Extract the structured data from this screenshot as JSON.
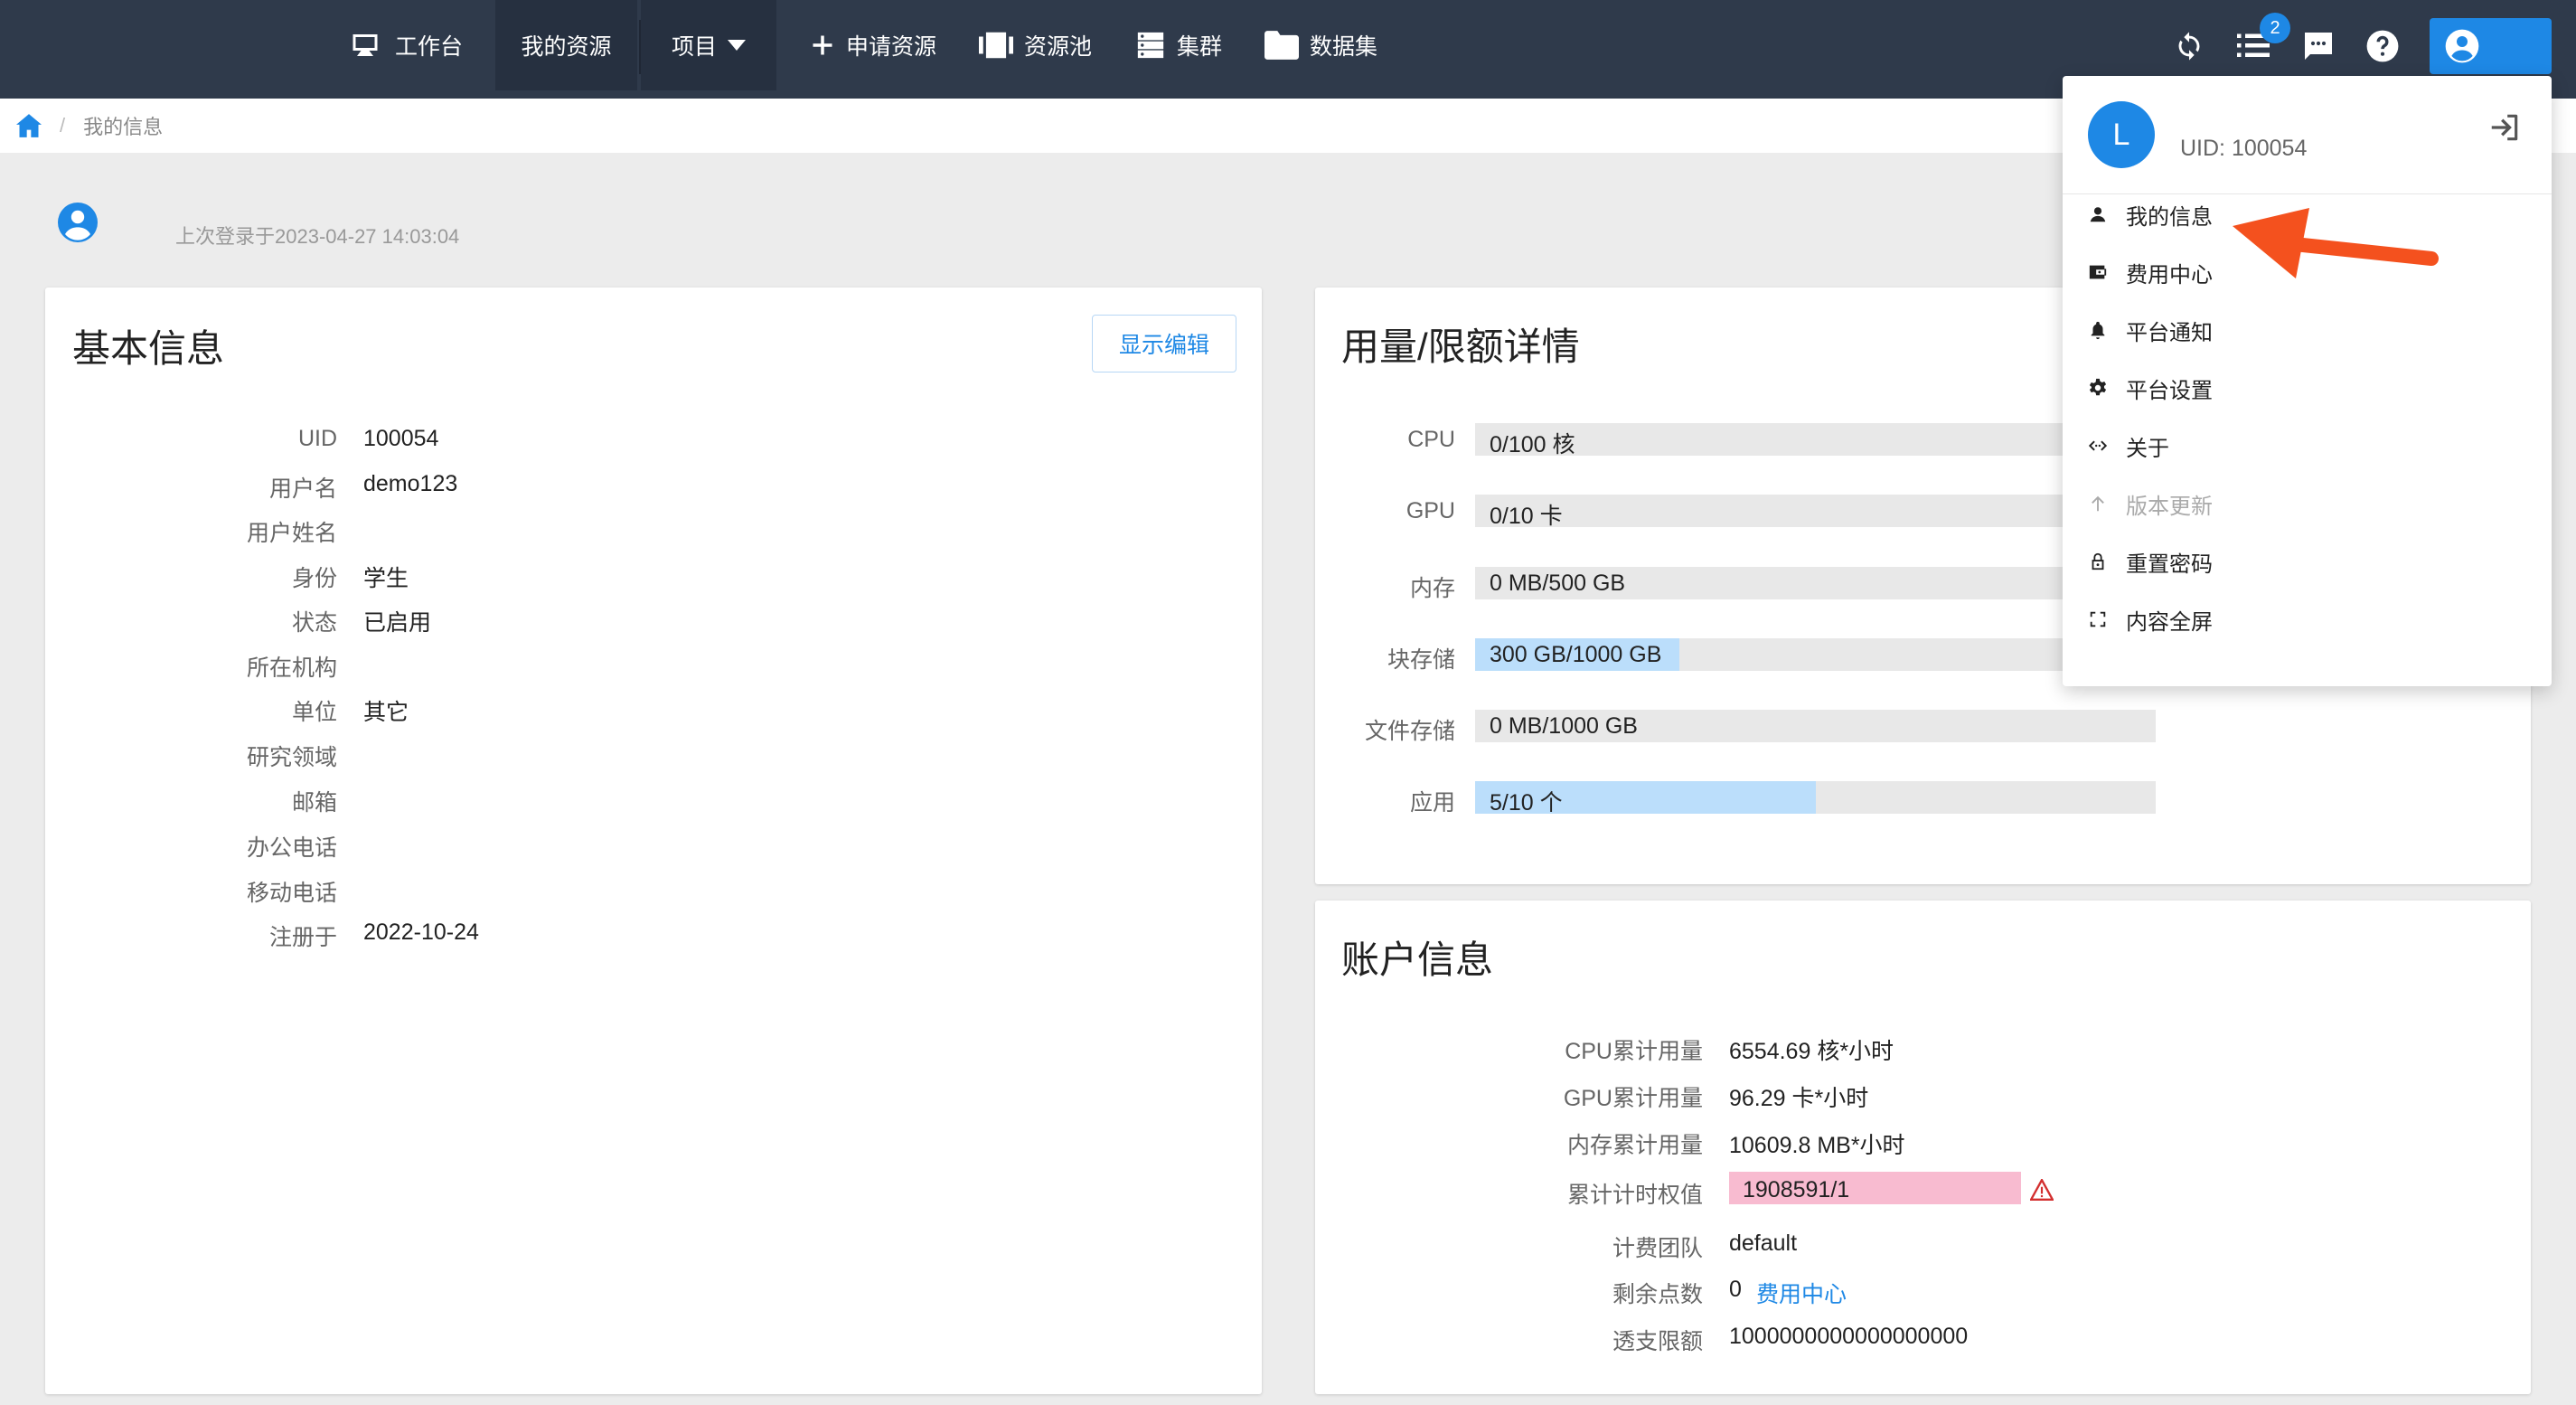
{
  "nav": {
    "workbench": "工作台",
    "my_resources": "我的资源",
    "project": "项目",
    "apply_resources": "申请资源",
    "resource_pool": "资源池",
    "cluster": "集群",
    "dataset": "数据集",
    "notification_count": "2"
  },
  "breadcrumb": {
    "current": "我的信息",
    "separator": "/"
  },
  "header": {
    "last_login": "上次登录于2023-04-27 14:03:04"
  },
  "basic_info": {
    "title": "基本信息",
    "edit_button": "显示编辑",
    "rows": [
      {
        "label": "UID",
        "value": "100054"
      },
      {
        "label": "用户名",
        "value": "demo123"
      },
      {
        "label": "用户姓名",
        "value": ""
      },
      {
        "label": "身份",
        "value": "学生"
      },
      {
        "label": "状态",
        "value": "已启用"
      },
      {
        "label": "所在机构",
        "value": ""
      },
      {
        "label": "单位",
        "value": "其它"
      },
      {
        "label": "研究领域",
        "value": ""
      },
      {
        "label": "邮箱",
        "value": ""
      },
      {
        "label": "办公电话",
        "value": ""
      },
      {
        "label": "移动电话",
        "value": ""
      },
      {
        "label": "注册于",
        "value": "2022-10-24"
      }
    ]
  },
  "usage": {
    "title": "用量/限额详情",
    "rows": [
      {
        "label": "CPU",
        "text": "0/100 核",
        "fraction": 0.0
      },
      {
        "label": "GPU",
        "text": "0/10 卡",
        "fraction": 0.0
      },
      {
        "label": "内存",
        "text": "0 MB/500 GB",
        "fraction": 0.0
      },
      {
        "label": "块存储",
        "text": "300 GB/1000 GB",
        "fraction": 0.3
      },
      {
        "label": "文件存储",
        "text": "0 MB/1000 GB",
        "fraction": 0.0
      },
      {
        "label": "应用",
        "text": "5/10 个",
        "fraction": 0.5
      }
    ]
  },
  "account": {
    "title": "账户信息",
    "rows": [
      {
        "label": "CPU累计用量",
        "value": "6554.69 核*小时"
      },
      {
        "label": "GPU累计用量",
        "value": "96.29 卡*小时"
      },
      {
        "label": "内存累计用量",
        "value": "10609.8 MB*小时"
      },
      {
        "label": "累计计时权值",
        "value": "1908591/1"
      },
      {
        "label": "计费团队",
        "value": "default"
      },
      {
        "label": "剩余点数",
        "value": "0"
      },
      {
        "label": "透支限额",
        "value": "1000000000000000000"
      }
    ],
    "billing_link": "费用中心"
  },
  "user_menu": {
    "avatar_letter": "L",
    "uid": "UID: 100054",
    "items": [
      {
        "label": "我的信息",
        "icon": "person-icon",
        "disabled": false
      },
      {
        "label": "费用中心",
        "icon": "wallet-icon",
        "disabled": false
      },
      {
        "label": "平台通知",
        "icon": "bell-icon",
        "disabled": false
      },
      {
        "label": "平台设置",
        "icon": "gear-icon",
        "disabled": false
      },
      {
        "label": "关于",
        "icon": "code-icon",
        "disabled": false
      },
      {
        "label": "版本更新",
        "icon": "arrow-up-icon",
        "disabled": true
      },
      {
        "label": "重置密码",
        "icon": "lock-icon",
        "disabled": false
      },
      {
        "label": "内容全屏",
        "icon": "fullscreen-icon",
        "disabled": false
      }
    ]
  },
  "colors": {
    "topbar": "#2f3a4b",
    "accent": "#1e88e5",
    "bar_fill": "#bbdefb",
    "warning_fill": "#f8bbd0",
    "annotation_arrow": "#f4511e"
  }
}
